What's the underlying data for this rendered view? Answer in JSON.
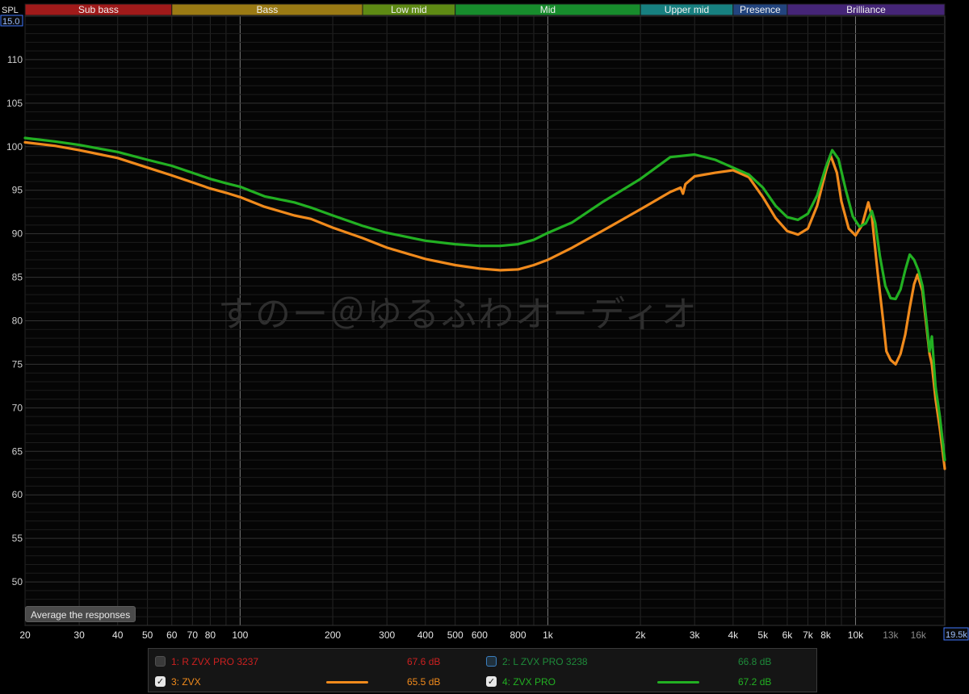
{
  "bands": [
    {
      "label": "Sub bass",
      "from": 20,
      "to": 60,
      "color": "#a01a1a"
    },
    {
      "label": "Bass",
      "from": 60,
      "to": 250,
      "color": "#9a7a14"
    },
    {
      "label": "Low mid",
      "from": 250,
      "to": 500,
      "color": "#5e8a14"
    },
    {
      "label": "Mid",
      "from": 500,
      "to": 2000,
      "color": "#178c2c"
    },
    {
      "label": "Upper mid",
      "from": 2000,
      "to": 4000,
      "color": "#178080"
    },
    {
      "label": "Presence",
      "from": 4000,
      "to": 6000,
      "color": "#22447e"
    },
    {
      "label": "Brilliance",
      "from": 6000,
      "to": 20000,
      "color": "#452577"
    }
  ],
  "watermark": "すのー＠ゆるふわオーディオ",
  "average_button": "Average the responses",
  "legend": [
    {
      "name": "1: R ZVX PRO 3237",
      "db": "67.6 dB",
      "checked": false,
      "color": "#cc2020",
      "swatch": false,
      "check_style": "off"
    },
    {
      "name": "2: L ZVX PRO 3238",
      "db": "66.8 dB",
      "checked": false,
      "color": "#1e8a3a",
      "swatch": false,
      "check_style": "off-blue"
    },
    {
      "name": "3: ZVX",
      "db": "65.5 dB",
      "checked": true,
      "color": "#f08a1c",
      "swatch": true,
      "check_style": "on"
    },
    {
      "name": "4: ZVX PRO",
      "db": "67.2 dB",
      "checked": true,
      "color": "#22b022",
      "swatch": true,
      "check_style": "on"
    }
  ],
  "chart_data": {
    "type": "line",
    "ylabel": "SPL",
    "xscale": "log",
    "xlim": [
      20,
      19500
    ],
    "ylim": [
      45,
      115
    ],
    "grid": true,
    "y_ticks": [
      50,
      55,
      60,
      65,
      70,
      75,
      80,
      85,
      90,
      95,
      100,
      105,
      110
    ],
    "y_top_label": "15.0",
    "x_right_label": "19.5k",
    "x_ticks": [
      {
        "v": 20,
        "label": "20"
      },
      {
        "v": 30,
        "label": "30"
      },
      {
        "v": 40,
        "label": "40"
      },
      {
        "v": 50,
        "label": "50"
      },
      {
        "v": 60,
        "label": "60"
      },
      {
        "v": 70,
        "label": "70"
      },
      {
        "v": 80,
        "label": "80"
      },
      {
        "v": 100,
        "label": "100"
      },
      {
        "v": 200,
        "label": "200"
      },
      {
        "v": 300,
        "label": "300"
      },
      {
        "v": 400,
        "label": "400"
      },
      {
        "v": 500,
        "label": "500"
      },
      {
        "v": 600,
        "label": "600"
      },
      {
        "v": 800,
        "label": "800"
      },
      {
        "v": 1000,
        "label": "1k"
      },
      {
        "v": 2000,
        "label": "2k"
      },
      {
        "v": 3000,
        "label": "3k"
      },
      {
        "v": 4000,
        "label": "4k"
      },
      {
        "v": 5000,
        "label": "5k"
      },
      {
        "v": 6000,
        "label": "6k"
      },
      {
        "v": 7000,
        "label": "7k"
      },
      {
        "v": 8000,
        "label": "8k"
      },
      {
        "v": 10000,
        "label": "10k"
      },
      {
        "v": 13000,
        "label": "13k",
        "dim": true
      },
      {
        "v": 16000,
        "label": "16k",
        "dim": true
      }
    ],
    "series": [
      {
        "name": "3: ZVX",
        "color": "#f08a1c",
        "points": [
          [
            20,
            100.5
          ],
          [
            25,
            100.1
          ],
          [
            30,
            99.6
          ],
          [
            40,
            98.7
          ],
          [
            50,
            97.6
          ],
          [
            60,
            96.7
          ],
          [
            70,
            95.9
          ],
          [
            80,
            95.2
          ],
          [
            90,
            94.7
          ],
          [
            100,
            94.2
          ],
          [
            120,
            93.1
          ],
          [
            150,
            92.1
          ],
          [
            170,
            91.7
          ],
          [
            200,
            90.7
          ],
          [
            250,
            89.5
          ],
          [
            300,
            88.4
          ],
          [
            400,
            87.1
          ],
          [
            500,
            86.4
          ],
          [
            600,
            86.0
          ],
          [
            700,
            85.8
          ],
          [
            800,
            85.9
          ],
          [
            900,
            86.4
          ],
          [
            1000,
            87.0
          ],
          [
            1200,
            88.4
          ],
          [
            1500,
            90.3
          ],
          [
            2000,
            92.8
          ],
          [
            2500,
            94.8
          ],
          [
            2700,
            95.3
          ],
          [
            2750,
            94.6
          ],
          [
            2800,
            95.7
          ],
          [
            3000,
            96.6
          ],
          [
            3500,
            97.0
          ],
          [
            4000,
            97.3
          ],
          [
            4500,
            96.5
          ],
          [
            5000,
            94.2
          ],
          [
            5500,
            91.8
          ],
          [
            6000,
            90.3
          ],
          [
            6500,
            89.9
          ],
          [
            7000,
            90.6
          ],
          [
            7500,
            93.2
          ],
          [
            8000,
            97.1
          ],
          [
            8300,
            99.0
          ],
          [
            8700,
            97.0
          ],
          [
            9000,
            93.7
          ],
          [
            9500,
            90.6
          ],
          [
            10000,
            89.8
          ],
          [
            10500,
            91.0
          ],
          [
            11000,
            93.6
          ],
          [
            11300,
            92.0
          ],
          [
            11800,
            85.5
          ],
          [
            12300,
            80.0
          ],
          [
            12600,
            76.5
          ],
          [
            13000,
            75.5
          ],
          [
            13500,
            75.0
          ],
          [
            14000,
            76.2
          ],
          [
            14500,
            78.4
          ],
          [
            15000,
            81.5
          ],
          [
            15500,
            84.2
          ],
          [
            15900,
            85.3
          ],
          [
            16500,
            83.4
          ],
          [
            17000,
            79.4
          ],
          [
            17400,
            76.2
          ],
          [
            17700,
            75.0
          ],
          [
            18200,
            71.0
          ],
          [
            18800,
            67.6
          ],
          [
            19200,
            65.0
          ],
          [
            19500,
            63.0
          ]
        ]
      },
      {
        "name": "4: ZVX PRO",
        "color": "#22b022",
        "points": [
          [
            20,
            101.0
          ],
          [
            25,
            100.6
          ],
          [
            30,
            100.2
          ],
          [
            40,
            99.4
          ],
          [
            50,
            98.5
          ],
          [
            60,
            97.8
          ],
          [
            70,
            97.0
          ],
          [
            80,
            96.3
          ],
          [
            90,
            95.8
          ],
          [
            100,
            95.4
          ],
          [
            120,
            94.3
          ],
          [
            150,
            93.6
          ],
          [
            170,
            93.0
          ],
          [
            200,
            92.1
          ],
          [
            250,
            90.9
          ],
          [
            300,
            90.1
          ],
          [
            400,
            89.2
          ],
          [
            500,
            88.8
          ],
          [
            600,
            88.6
          ],
          [
            700,
            88.6
          ],
          [
            800,
            88.8
          ],
          [
            900,
            89.3
          ],
          [
            1000,
            90.1
          ],
          [
            1200,
            91.3
          ],
          [
            1500,
            93.6
          ],
          [
            2000,
            96.3
          ],
          [
            2500,
            98.8
          ],
          [
            3000,
            99.1
          ],
          [
            3500,
            98.5
          ],
          [
            4000,
            97.6
          ],
          [
            4500,
            96.8
          ],
          [
            5000,
            95.3
          ],
          [
            5500,
            93.2
          ],
          [
            6000,
            91.9
          ],
          [
            6500,
            91.6
          ],
          [
            7000,
            92.3
          ],
          [
            7500,
            94.4
          ],
          [
            8000,
            97.6
          ],
          [
            8400,
            99.6
          ],
          [
            8800,
            98.6
          ],
          [
            9300,
            95.0
          ],
          [
            9800,
            92.0
          ],
          [
            10300,
            90.8
          ],
          [
            10800,
            91.2
          ],
          [
            11300,
            92.6
          ],
          [
            11600,
            91.2
          ],
          [
            12000,
            87.4
          ],
          [
            12500,
            84.0
          ],
          [
            13000,
            82.6
          ],
          [
            13500,
            82.5
          ],
          [
            14000,
            83.6
          ],
          [
            14500,
            85.8
          ],
          [
            15000,
            87.6
          ],
          [
            15500,
            87.0
          ],
          [
            16000,
            85.8
          ],
          [
            16500,
            84.0
          ],
          [
            17000,
            80.0
          ],
          [
            17400,
            76.5
          ],
          [
            17700,
            78.2
          ],
          [
            18200,
            72.4
          ],
          [
            18800,
            69.0
          ],
          [
            19500,
            64.0
          ]
        ]
      }
    ]
  }
}
